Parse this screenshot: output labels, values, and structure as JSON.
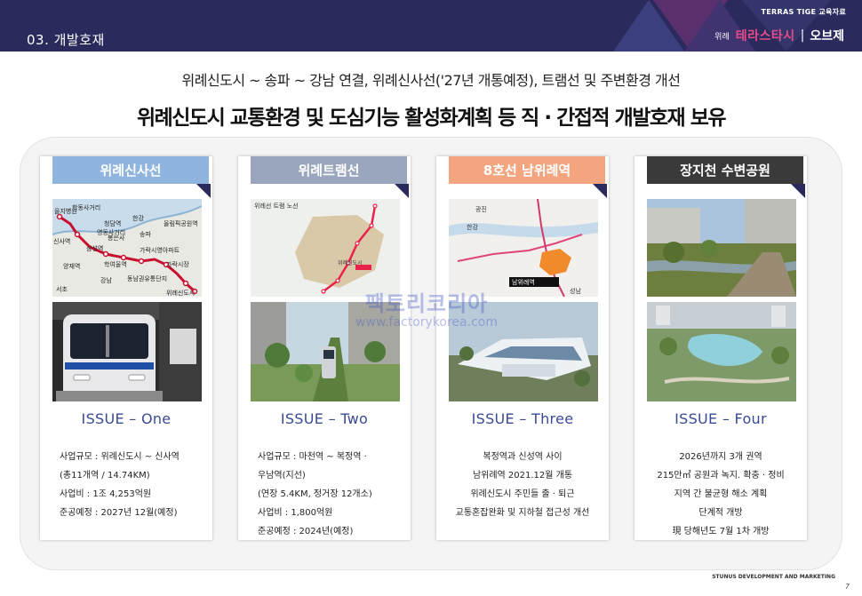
{
  "header": {
    "section_title": "03. 개발호재",
    "doc_label": "TERRAS TIGE 교육자료",
    "brand_small": "위례",
    "brand_main": "테라스타시",
    "brand_sep": "|",
    "brand_sub": "오브제"
  },
  "headline": {
    "line1": "위례신도시 ~ 송파 ~ 강남 연결, 위례신사선('27년 개통예정), 트램선 및 주변환경 개선",
    "line2": "위례신도시 교통환경 및 도심기능 활성화계획 등 직 · 간접적 개발호재 보유"
  },
  "colors": {
    "card1_tag": "#8fb4de",
    "card2_tag": "#9aa6bd",
    "card3_tag": "#f2a57e",
    "card4_tag": "#3a3a3a",
    "issue_text": "#3a4a94",
    "header_bg": "#2a2a5c"
  },
  "cards": [
    {
      "tag": "위례신사선",
      "issue": "ISSUE – One",
      "lines": [
        "사업규모 : 위례신도시 ~ 신사역",
        "(총11개역 / 14.74KM)",
        "사업비 : 1조 4,253억원",
        "준공예정 : 2027년 12월(예정)"
      ],
      "map_labels": [
        "을지병원",
        "학동사거리",
        "청담역",
        "영동사거리",
        "한강",
        "송파",
        "올림픽공원역",
        "신사역",
        "삼성역",
        "봉은사",
        "가락시영아파트",
        "양재역",
        "학여울역",
        "가락시장",
        "강남",
        "동남권유통단지",
        "서초",
        "위례신도시"
      ]
    },
    {
      "tag": "위례트램선",
      "issue": "ISSUE – Two",
      "lines": [
        "사업규모 : 마천역 ~ 복정역 ·",
        "우남역(지선)",
        "(연장 5.4KM, 정거장 12개소)",
        "사업비 : 1,800억원",
        "준공예정 : 2024년(예정)"
      ],
      "map_labels": [
        "위례선 트램 노선",
        "위례신도시"
      ]
    },
    {
      "tag": "8호선 남위례역",
      "issue": "ISSUE – Three",
      "lines": [
        "복정역과 신성역 사이",
        "남위례역 2021.12월 개통",
        "위례신도시 주민들 출 · 퇴근",
        "교통혼잡완화 및 지하철 접근성 개선"
      ],
      "map_labels": [
        "광진",
        "한강",
        "남위례역",
        "성남"
      ]
    },
    {
      "tag": "장지천 수변공원",
      "issue": "ISSUE – Four",
      "lines": [
        "2026년까지 3개 권역",
        "215만㎡ 공원과 녹지. 확충 · 정비",
        "지역 간 불균형 해소 계획",
        "단계적 개방",
        "現 당해년도 7월 1차 개방"
      ]
    }
  ],
  "watermark": {
    "line1": "팩토리코리아",
    "line2": "www.factorykorea.com"
  },
  "footer": {
    "label": "STUNUS DEVELOPMENT AND MARKETING",
    "page_number": "7"
  }
}
